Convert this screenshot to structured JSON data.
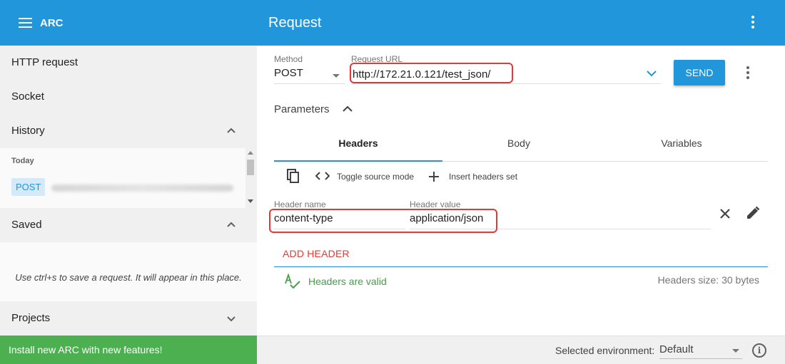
{
  "app": {
    "title": "ARC"
  },
  "header": {
    "title": "Request"
  },
  "sidebar": {
    "items": [
      {
        "label": "HTTP request"
      },
      {
        "label": "Socket"
      },
      {
        "label": "History"
      },
      {
        "label": "Saved"
      },
      {
        "label": "Projects"
      }
    ],
    "history": {
      "group_label": "Today",
      "entries": [
        {
          "method": "POST"
        }
      ]
    },
    "saved": {
      "hint": "Use ctrl+s to save a request. It will appear in this place."
    }
  },
  "footer": {
    "install_banner": "Install new ARC with new features!",
    "env_label": "Selected environment:",
    "env_value": "Default"
  },
  "request": {
    "method_label": "Method",
    "method_value": "POST",
    "url_label": "Request URL",
    "url_value": "http://172.21.0.121/test_json/",
    "send_label": "SEND",
    "parameters_label": "Parameters"
  },
  "tabs": [
    {
      "label": "Headers",
      "active": true
    },
    {
      "label": "Body",
      "active": false
    },
    {
      "label": "Variables",
      "active": false
    }
  ],
  "toolbar": {
    "toggle_source": "Toggle source mode",
    "insert_headers": "Insert headers set"
  },
  "headers": {
    "name_label": "Header name",
    "value_label": "Header value",
    "rows": [
      {
        "name": "content-type",
        "value": "application/json"
      }
    ],
    "add_label": "ADD HEADER",
    "valid_text": "Headers are valid",
    "size_text": "Headers size: 30 bytes"
  },
  "colors": {
    "primary": "#2196db",
    "success": "#4caf50",
    "valid_green": "#43a047",
    "add_red": "#e53935",
    "highlight": "#e53935"
  },
  "icons": [
    "menu-icon",
    "more-vert-icon",
    "chevron-up-icon",
    "chevron-down-icon",
    "copy-icon",
    "code-icon",
    "plus-icon",
    "close-icon",
    "pencil-icon",
    "spellcheck-icon",
    "info-icon"
  ]
}
